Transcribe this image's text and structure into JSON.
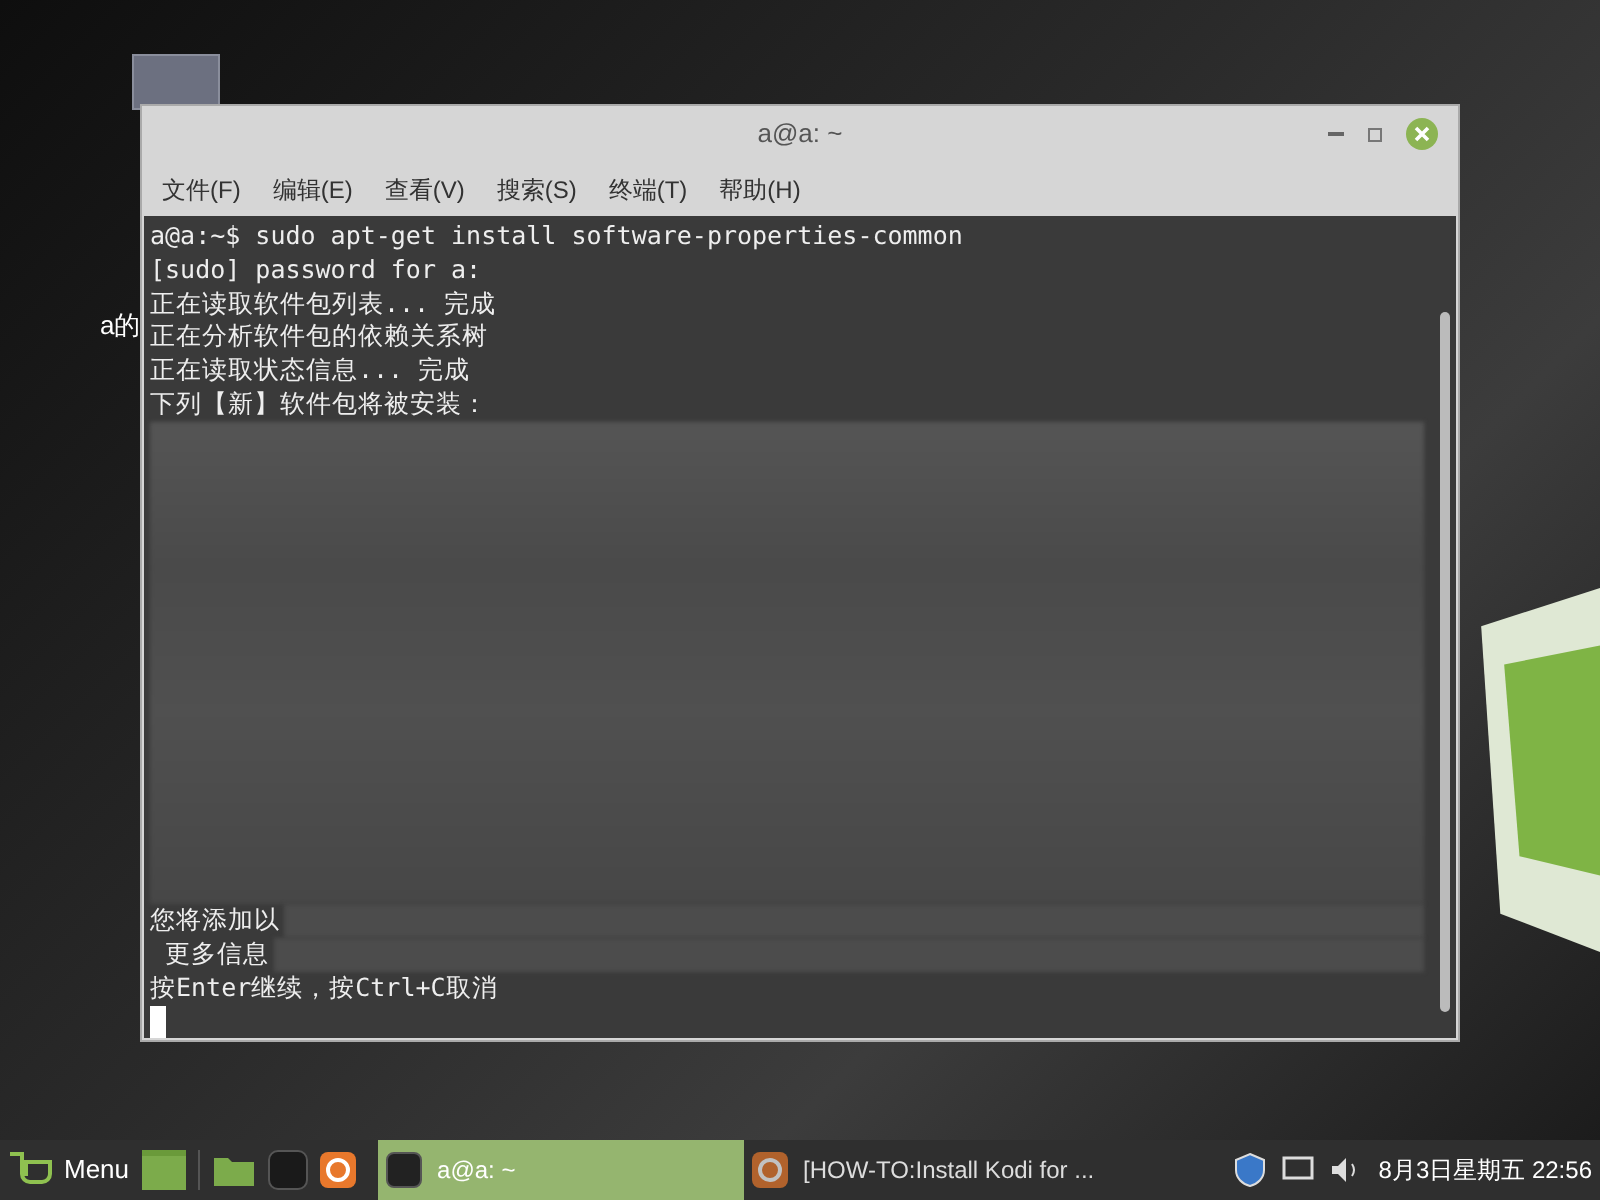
{
  "desktop": {
    "icon_label": "a的"
  },
  "window": {
    "title": "a@a: ~"
  },
  "menu": [
    "文件(F)",
    "编辑(E)",
    "查看(V)",
    "搜索(S)",
    "终端(T)",
    "帮助(H)"
  ],
  "terminal": {
    "top_lines": [
      "a@a:~$ sudo apt-get install software-properties-common",
      "[sudo] password for a:",
      "正在读取软件包列表... 完成",
      "正在分析软件包的依赖关系树",
      "正在读取状态信息... 完成",
      "下列【新】软件包将被安装："
    ],
    "bottom_lines": [
      "您将添加以",
      " 更多信息",
      "按Enter继续，按Ctrl+C取消"
    ]
  },
  "taskbar": {
    "menu_label": "Menu",
    "tasks": [
      {
        "label": "a@a: ~",
        "kind": "terminal",
        "selected": true
      },
      {
        "label": "[HOW-TO:Install Kodi for ...",
        "kind": "browser",
        "selected": false
      }
    ],
    "clock": "8月3日星期五 22:56"
  }
}
